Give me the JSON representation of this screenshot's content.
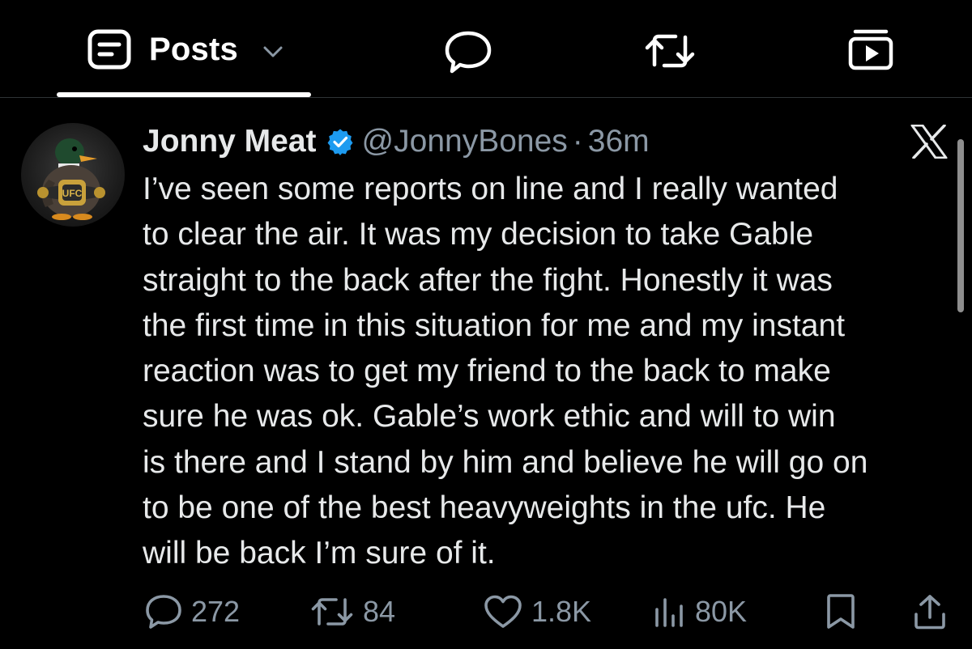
{
  "tabs": {
    "posts_label": "Posts"
  },
  "icons": {
    "posts": "posts-icon",
    "dropdown": "chevron-down-icon",
    "reply_tab": "speech-bubble-icon",
    "repost_tab": "repost-icon",
    "video_tab": "video-icon",
    "verified": "verified-badge-icon",
    "brand": "x-logo-icon"
  },
  "tweet": {
    "display_name": "Jonny Meat",
    "handle": "@JonnyBones",
    "separator": "·",
    "time": "36m",
    "avatar_text": "UFC",
    "text_lines": [
      "I’ve seen some reports on line and I really wanted",
      "to clear the air. It was my decision to take Gable",
      "straight to the back after the fight. Honestly it was",
      "the first time in this situation for me and my instant",
      "reaction was to get my friend to the back to make",
      "sure he was ok. Gable’s work ethic and will to win",
      "is there and I stand by him and believe he will go on",
      "to be one of the best heavyweights in the ufc. He",
      "will be back I’m sure of it."
    ]
  },
  "actions": {
    "replies": "272",
    "reposts": "84",
    "likes": "1.8K",
    "views": "80K"
  },
  "colors": {
    "background": "#000000",
    "text_primary": "#e7e9ea",
    "text_secondary": "#8b98a5",
    "verified_blue": "#1d9bf0",
    "divider": "#2f3336"
  }
}
